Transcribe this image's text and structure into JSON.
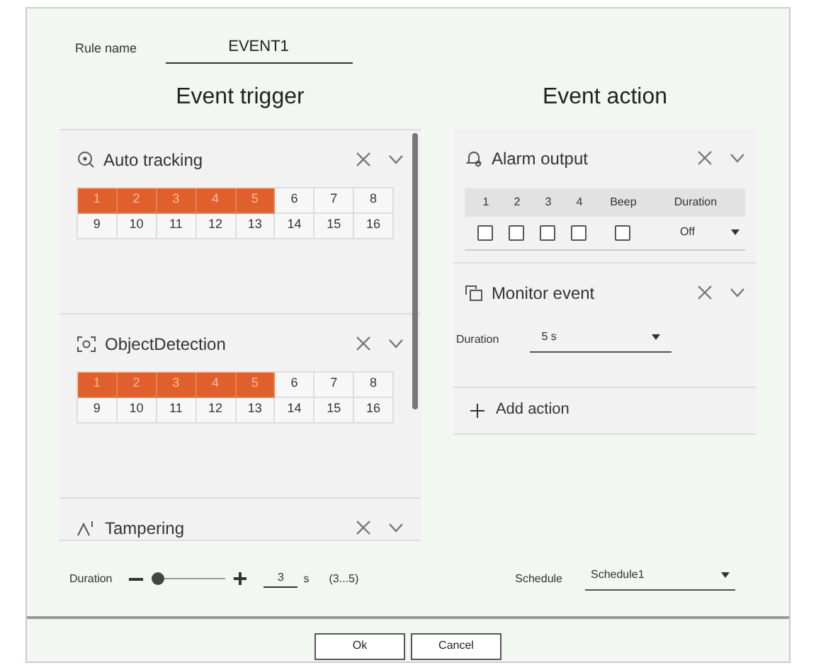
{
  "rule_name": {
    "label": "Rule name",
    "value": "EVENT1"
  },
  "trigger": {
    "title": "Event trigger",
    "events": [
      {
        "kind": "tracking",
        "name": "Auto tracking",
        "channels": [
          {
            "label": "1",
            "selected": true
          },
          {
            "label": "2",
            "selected": true
          },
          {
            "label": "3",
            "selected": true
          },
          {
            "label": "4",
            "selected": true
          },
          {
            "label": "5",
            "selected": true
          },
          {
            "label": "6",
            "selected": false
          },
          {
            "label": "7",
            "selected": false
          },
          {
            "label": "8",
            "selected": false
          },
          {
            "label": "9",
            "selected": false
          },
          {
            "label": "10",
            "selected": false
          },
          {
            "label": "11",
            "selected": false
          },
          {
            "label": "12",
            "selected": false
          },
          {
            "label": "13",
            "selected": false
          },
          {
            "label": "14",
            "selected": false
          },
          {
            "label": "15",
            "selected": false
          },
          {
            "label": "16",
            "selected": false
          }
        ]
      },
      {
        "kind": "object",
        "name": "ObjectDetection",
        "channels": [
          {
            "label": "1",
            "selected": true
          },
          {
            "label": "2",
            "selected": true
          },
          {
            "label": "3",
            "selected": true
          },
          {
            "label": "4",
            "selected": true
          },
          {
            "label": "5",
            "selected": true
          },
          {
            "label": "6",
            "selected": false
          },
          {
            "label": "7",
            "selected": false
          },
          {
            "label": "8",
            "selected": false
          },
          {
            "label": "9",
            "selected": false
          },
          {
            "label": "10",
            "selected": false
          },
          {
            "label": "11",
            "selected": false
          },
          {
            "label": "12",
            "selected": false
          },
          {
            "label": "13",
            "selected": false
          },
          {
            "label": "14",
            "selected": false
          },
          {
            "label": "15",
            "selected": false
          },
          {
            "label": "16",
            "selected": false
          }
        ]
      },
      {
        "kind": "tampering",
        "name": "Tampering"
      }
    ],
    "duration": {
      "label": "Duration",
      "level": 0,
      "value": "3",
      "unit": "s",
      "range": "(3...5)"
    }
  },
  "action": {
    "title": "Event action",
    "alarm_output": {
      "name": "Alarm output",
      "columns": [
        "1",
        "2",
        "3",
        "4",
        "Beep",
        "Duration"
      ],
      "outputs": [
        {
          "checked": false
        },
        {
          "checked": false
        },
        {
          "checked": false
        },
        {
          "checked": false
        },
        {
          "checked": false
        }
      ],
      "duration": "Off"
    },
    "monitor_event": {
      "name": "Monitor event",
      "label": "Duration",
      "value": "5 s"
    },
    "add_action": "Add action",
    "schedule": {
      "label": "Schedule",
      "value": "Schedule1"
    }
  },
  "buttons": [
    "Ok",
    "Cancel"
  ]
}
